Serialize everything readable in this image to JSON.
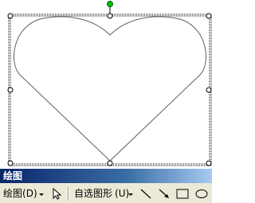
{
  "drawing_toolbar": {
    "title": "绘图",
    "draw_menu_label": "绘图",
    "draw_menu_accel": "(D)",
    "autoshapes_label": "自选图形",
    "autoshapes_accel": "(U)"
  },
  "icons": {
    "select_objects": "arrow-pointer-icon",
    "line": "line-icon",
    "arrow": "arrow-icon",
    "rectangle": "rectangle-icon",
    "oval": "oval-icon",
    "rotate_handle": "rotate-handle-icon"
  },
  "colors": {
    "title_bar": "#0a246a",
    "toolbar_bg": "#ece9d8",
    "rotate_handle": "#00c000",
    "heart_stroke": "#606060"
  }
}
